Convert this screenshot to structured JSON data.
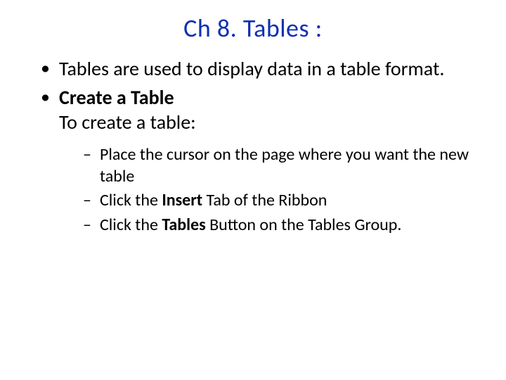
{
  "title": "Ch 8. Tables :",
  "bullet1": "Tables are used to display data in a table format.",
  "bullet2_strong": "Create a Table",
  "bullet2_line2": "To create a table:",
  "sub1": "Place the cursor on the page where you want the new table",
  "sub2_pre": "Click the ",
  "sub2_bold": "Insert",
  "sub2_post": " Tab of the Ribbon",
  "sub3_pre": "Click the ",
  "sub3_bold": "Tables",
  "sub3_post": " Button on the Tables Group."
}
